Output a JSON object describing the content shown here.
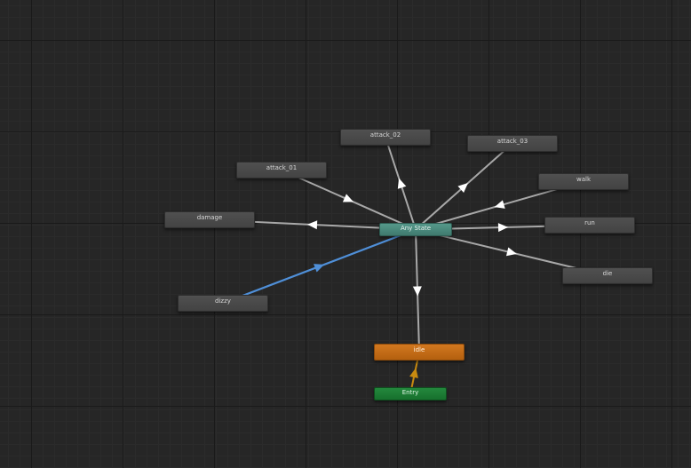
{
  "graph": {
    "states": {
      "attack_02": "attack_02",
      "attack_03": "attack_03",
      "attack_01": "attack_01",
      "walk": "walk",
      "damage": "damage",
      "run": "run",
      "any_state": "Any State",
      "die": "die",
      "dizzy": "dizzy",
      "idle": "idle",
      "entry": "Entry"
    },
    "colors": {
      "background": "#262626",
      "state_node": "#4a4a4a",
      "any_state_node": "#4d8d80",
      "default_state_node": "#c86d18",
      "entry_node": "#1f7d36",
      "transition": "#a8a8a8",
      "selected_transition": "#4f8fd8",
      "entry_transition": "#c88a10"
    },
    "transitions": [
      {
        "from": "any_state",
        "to": "attack_02",
        "selected": false
      },
      {
        "from": "any_state",
        "to": "attack_03",
        "selected": false
      },
      {
        "from": "attack_01",
        "to": "any_state",
        "selected": false
      },
      {
        "from": "walk",
        "to": "any_state",
        "selected": false
      },
      {
        "from": "any_state",
        "to": "damage",
        "selected": false
      },
      {
        "from": "any_state",
        "to": "run",
        "selected": false
      },
      {
        "from": "any_state",
        "to": "die",
        "selected": false
      },
      {
        "from": "dizzy",
        "to": "any_state",
        "selected": true
      },
      {
        "from": "any_state",
        "to": "idle",
        "selected": false
      },
      {
        "from": "entry",
        "to": "idle",
        "selected": false
      }
    ]
  }
}
